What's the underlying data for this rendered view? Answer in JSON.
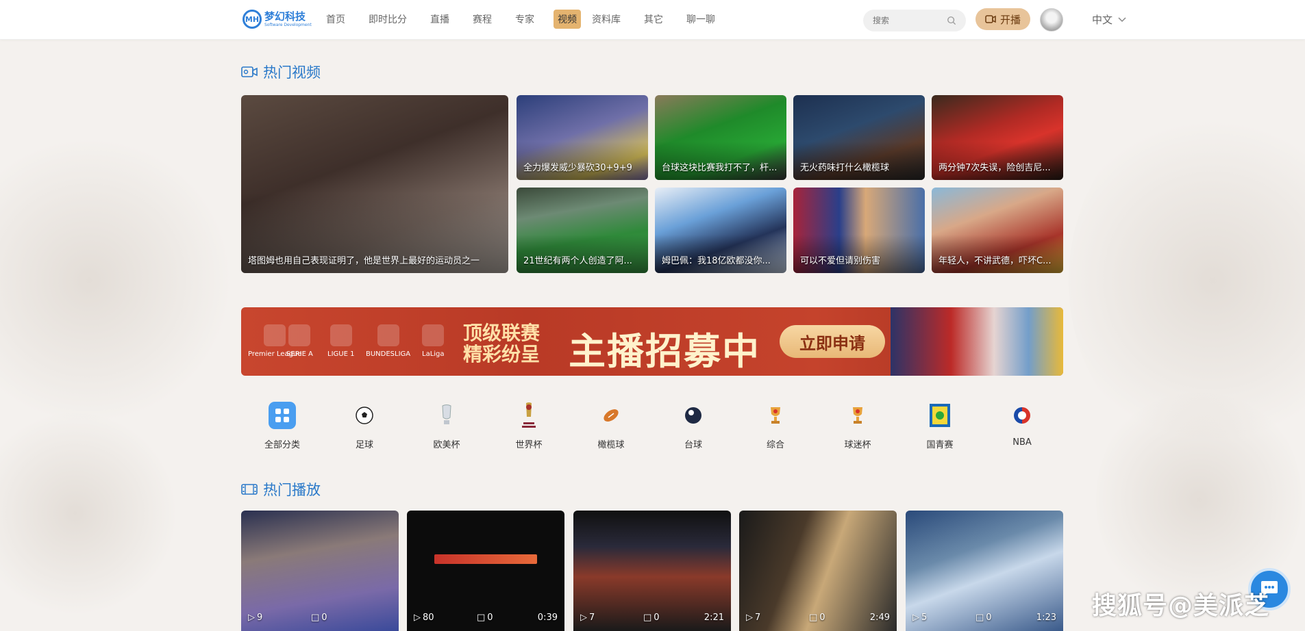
{
  "header": {
    "logo_title": "梦幻科技",
    "logo_subtitle": "Software Development",
    "logo_mark": "MH",
    "nav": [
      {
        "label": "首页"
      },
      {
        "label": "即时比分"
      },
      {
        "label": "直播"
      },
      {
        "label": "赛程"
      },
      {
        "label": "专家"
      },
      {
        "label": "视频",
        "active": true
      },
      {
        "label": "资料库"
      },
      {
        "label": "其它"
      },
      {
        "label": "聊一聊"
      }
    ],
    "search_placeholder": "搜索",
    "live_button": "开播",
    "language": "中文"
  },
  "hot_videos": {
    "title": "热门视频",
    "featured": {
      "caption": "塔图姆也用自己表现证明了，他是世界上最好的运动员之一"
    },
    "items": [
      {
        "caption": "全力爆发威少暴砍30+9+9"
      },
      {
        "caption": "台球这块比赛我打不了，杆..."
      },
      {
        "caption": "无火药味打什么橄榄球"
      },
      {
        "caption": "两分钟7次失误，险创吉尼..."
      },
      {
        "caption": "21世纪有两个人创造了阿..."
      },
      {
        "caption": "姆巴佩：我18亿欧都没你..."
      },
      {
        "caption": "可以不爱但请别伤害"
      },
      {
        "caption": "年轻人，不讲武德，吓坏C..."
      }
    ]
  },
  "banner": {
    "leagues": [
      "Premier League",
      "SERIE A",
      "LIGUE 1",
      "BUNDESLIGA",
      "LaLiga"
    ],
    "slogan_line1": "顶级联赛",
    "slogan_line2": "精彩纷呈",
    "headline": "主播招募中",
    "apply_button": "立即申请"
  },
  "categories": [
    {
      "label": "全部分类",
      "icon": "grid-icon"
    },
    {
      "label": "足球",
      "icon": "soccer-ball-icon"
    },
    {
      "label": "欧美杯",
      "icon": "euro-cup-icon"
    },
    {
      "label": "世界杯",
      "icon": "world-cup-icon"
    },
    {
      "label": "橄榄球",
      "icon": "rugby-ball-icon"
    },
    {
      "label": "台球",
      "icon": "billiard-ball-icon"
    },
    {
      "label": "综合",
      "icon": "trophy-icon"
    },
    {
      "label": "球迷杯",
      "icon": "trophy-icon"
    },
    {
      "label": "国青赛",
      "icon": "youth-cup-icon"
    },
    {
      "label": "NBA",
      "icon": "nba-icon"
    }
  ],
  "hot_play": {
    "title": "热门播放",
    "items": [
      {
        "views": "9",
        "comments": "0",
        "duration": ""
      },
      {
        "views": "80",
        "comments": "0",
        "duration": "0:39"
      },
      {
        "views": "7",
        "comments": "0",
        "duration": "2:21"
      },
      {
        "views": "7",
        "comments": "0",
        "duration": "2:49"
      },
      {
        "views": "5",
        "comments": "0",
        "duration": "1:23"
      }
    ]
  },
  "watermark": "搜狐号@美派芝",
  "colors": {
    "accent": "#2a79c9",
    "active_nav": "#e4b36f",
    "live_button": "#e8c49a"
  }
}
